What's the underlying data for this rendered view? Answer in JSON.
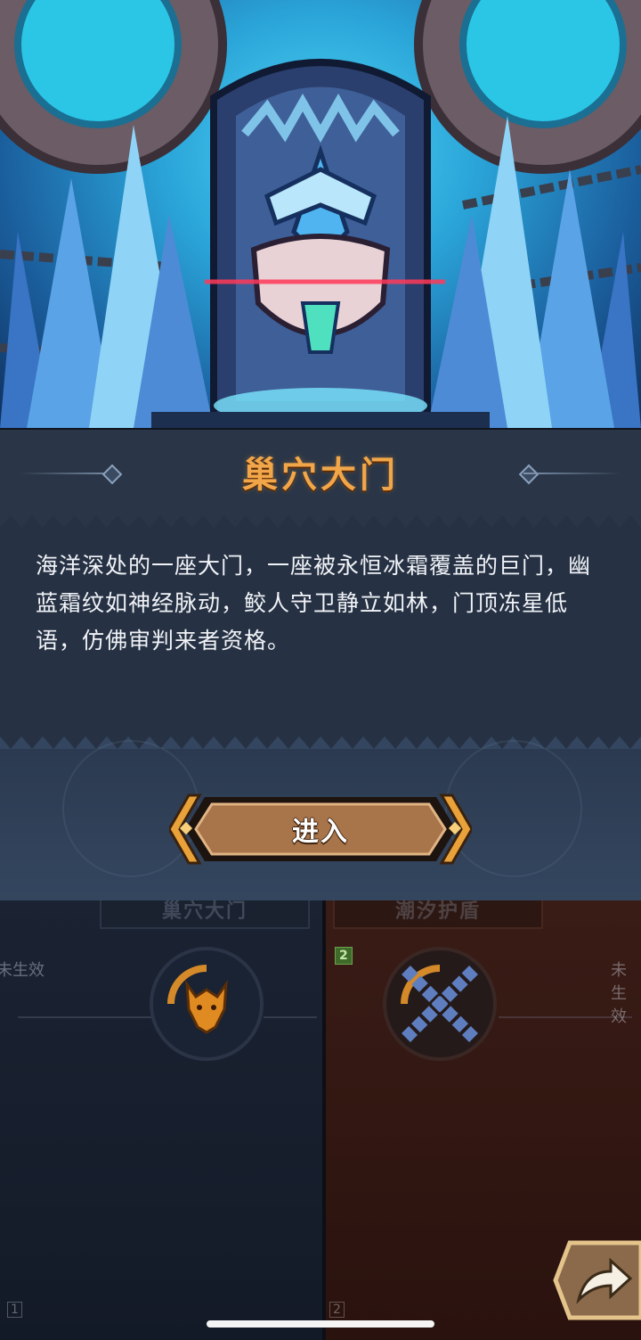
{
  "dialog": {
    "title": "巢穴大门",
    "description": "海洋深处的一座大门，一座被永恒冰霜覆盖的巨门，幽蓝霜纹如神经脉动，鲛人守卫静立如林，门顶冻星低语，仿佛审判来者资格。",
    "enter_label": "进入"
  },
  "background_cards": {
    "left": {
      "title": "巢穴大门",
      "level": "1",
      "status": "未生效",
      "emblem": "dragon-head-icon"
    },
    "right": {
      "title": "潮汐护盾",
      "level": "2",
      "status": "未生效",
      "emblem": "crossed-chains-icon"
    }
  },
  "colors": {
    "title": "#f2a64a",
    "panel": "#2a3647",
    "button": "#a8744a",
    "ice": "#6fd0f3"
  },
  "share_icon": "share-arrow-icon"
}
